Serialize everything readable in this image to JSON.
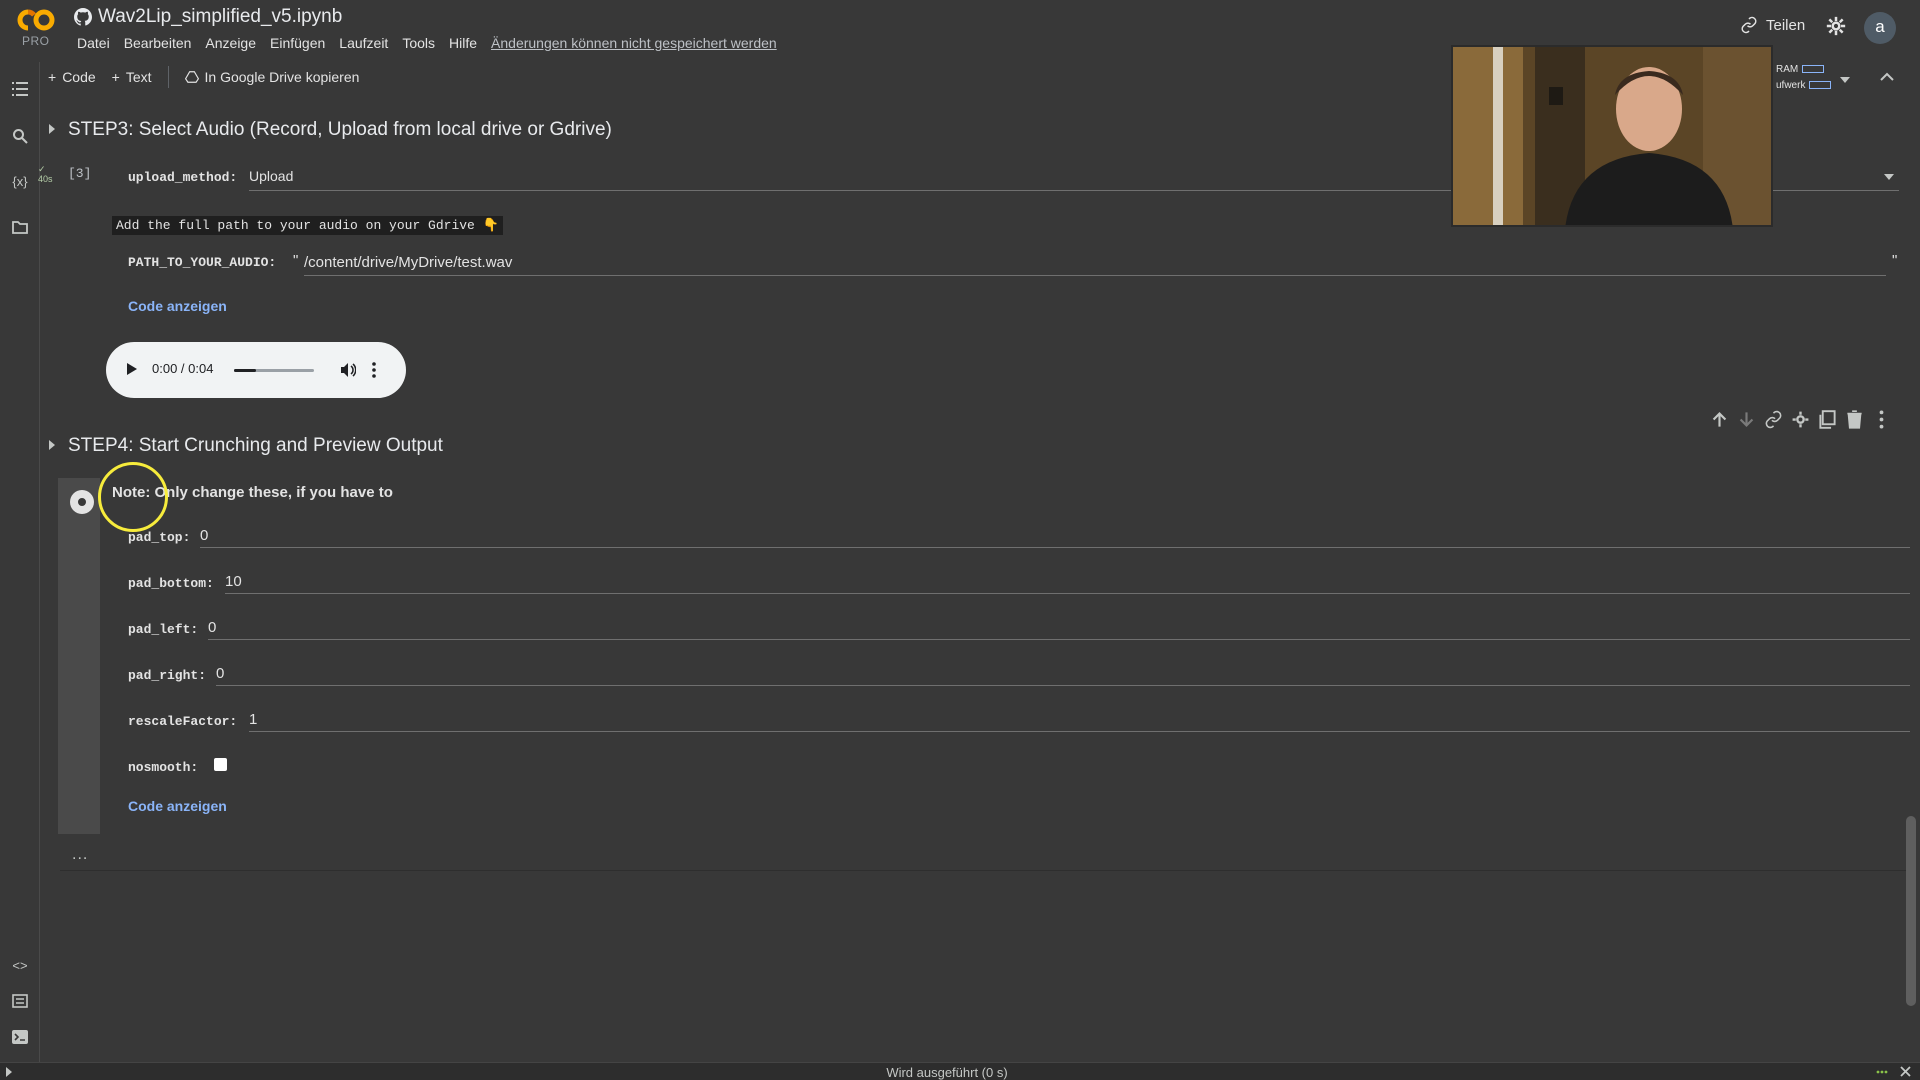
{
  "app": {
    "brand_badge": "PRO",
    "notebook_name": "Wav2Lip_simplified_v5.ipynb",
    "share_label": "Teilen",
    "avatar_letter": "a"
  },
  "menu": {
    "items": [
      "Datei",
      "Bearbeiten",
      "Anzeige",
      "Einfügen",
      "Laufzeit",
      "Tools",
      "Hilfe"
    ],
    "unsaved_notice": "Änderungen können nicht gespeichert werden"
  },
  "toolbar": {
    "add_code": "Code",
    "add_text": "Text",
    "copy_to_drive": "In Google Drive kopieren",
    "ram_label": "RAM",
    "disk_label": "ufwerk"
  },
  "step3": {
    "title": "STEP3: Select Audio (Record, Upload from local drive or Gdrive)",
    "exec_count": "[3]",
    "exec_time": "40s",
    "upload_method_label": "upload_method:",
    "upload_method_value": "Upload",
    "hint": "Add the full path to your audio on your Gdrive",
    "hint_emoji": "👇",
    "path_label": "PATH_TO_YOUR_AUDIO:",
    "path_quote_open": "\"",
    "path_value": "/content/drive/MyDrive/test.wav",
    "path_quote_close": "\"",
    "show_code": "Code anzeigen",
    "audio_time": "0:00 / 0:04",
    "audio_volume_fraction": 0.95
  },
  "step4": {
    "title": "STEP4: Start Crunching and Preview Output",
    "note": "Note: Only change these, if you have to",
    "fields": [
      {
        "label": "pad_top:",
        "value": "0"
      },
      {
        "label": "pad_bottom:",
        "value": "10"
      },
      {
        "label": "pad_left:",
        "value": "0"
      },
      {
        "label": "pad_right:",
        "value": "0"
      },
      {
        "label": "rescaleFactor:",
        "value": "1"
      }
    ],
    "nosmooth_label": "nosmooth:",
    "nosmooth_checked": false,
    "show_code": "Code anzeigen",
    "more": "..."
  },
  "status": {
    "text": "Wird ausgeführt (0 s)"
  },
  "colors": {
    "background": "#383838",
    "link": "#8ab4f8",
    "logo_orange": "#f9ab00",
    "logo_amber": "#e37400",
    "cursor_highlight": "#f7ec3c"
  }
}
